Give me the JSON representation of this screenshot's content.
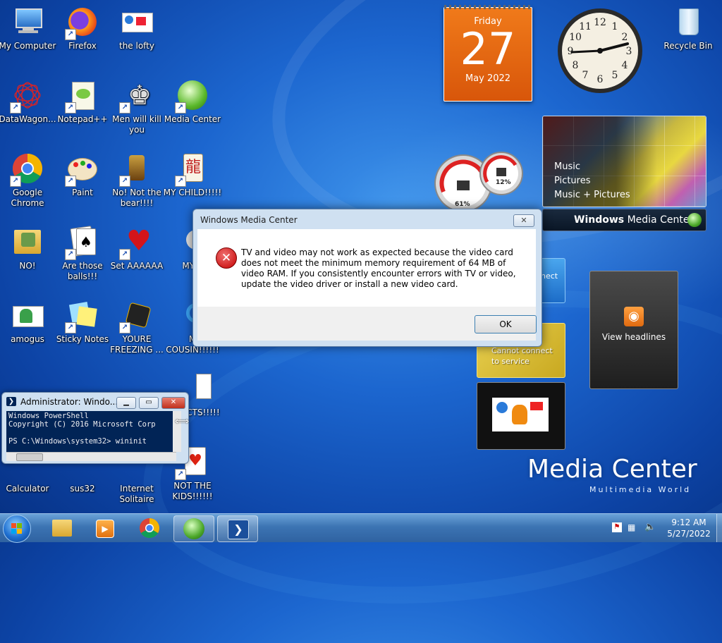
{
  "desktop": {
    "icons": [
      {
        "label": "My Computer"
      },
      {
        "label": "Firefox"
      },
      {
        "label": "the lofty"
      },
      {
        "label": "DataWagon..."
      },
      {
        "label": "Notepad++"
      },
      {
        "label": "Men will kill you"
      },
      {
        "label": "Media Center"
      },
      {
        "label": "Google Chrome"
      },
      {
        "label": "Paint"
      },
      {
        "label": "No! Not the bear!!!!"
      },
      {
        "label": "MY CHILD!!!!!"
      },
      {
        "label": "NO!"
      },
      {
        "label": "Are those balls!!!"
      },
      {
        "label": "Set AAAAAA"
      },
      {
        "label": "MY K"
      },
      {
        "label": "amogus"
      },
      {
        "label": "Sticky Notes"
      },
      {
        "label": "YOURE FREEZING ..."
      },
      {
        "label": "M COUSIN!!!!!!"
      },
      {
        "label": "CTS!!!!!"
      },
      {
        "label": "Calculator"
      },
      {
        "label": "sus32"
      },
      {
        "label": "Internet Solitaire"
      },
      {
        "label": "NOT THE KIDS!!!!!!"
      },
      {
        "label": "Recycle Bin"
      }
    ]
  },
  "calendar": {
    "weekday": "Friday",
    "day": "27",
    "month_year": "May 2022"
  },
  "meters": {
    "cpu": "61%",
    "mem": "12%"
  },
  "mc_gadget": {
    "items": [
      "Music",
      "Pictures",
      "Music + Pictures"
    ],
    "title_bold": "Windows",
    "title_rest": " Media Center"
  },
  "feed_gadget": {
    "label": "View headlines"
  },
  "connect_gadget": {
    "line1": "Cannot connect",
    "line2": "to service",
    "partial": "nect"
  },
  "brand": {
    "title": "Media Center",
    "subtitle": "Multimedia World"
  },
  "dialog": {
    "title": "Windows Media Center",
    "close": "✕",
    "message": "TV and video may not work as expected because the video card does not meet the minimum memory requirement of 64 MB of video RAM. If you consistently encounter errors with TV or video, update the video driver or install a new video card.",
    "ok_label": "OK"
  },
  "powershell": {
    "title": "Administrator: Windo...",
    "console_text": "Windows PowerShell\nCopyright (C) 2016 Microsoft Corp\n\nPS C:\\Windows\\system32> wininit"
  },
  "taskbar": {
    "apps": [
      "explorer-icon",
      "media-player-icon",
      "chrome-icon",
      "media-center-icon",
      "powershell-icon"
    ],
    "time": "9:12 AM",
    "date": "5/27/2022"
  },
  "colors": {
    "calendar": "#e8650b",
    "error": "#c40000",
    "console_bg": "#012456"
  }
}
